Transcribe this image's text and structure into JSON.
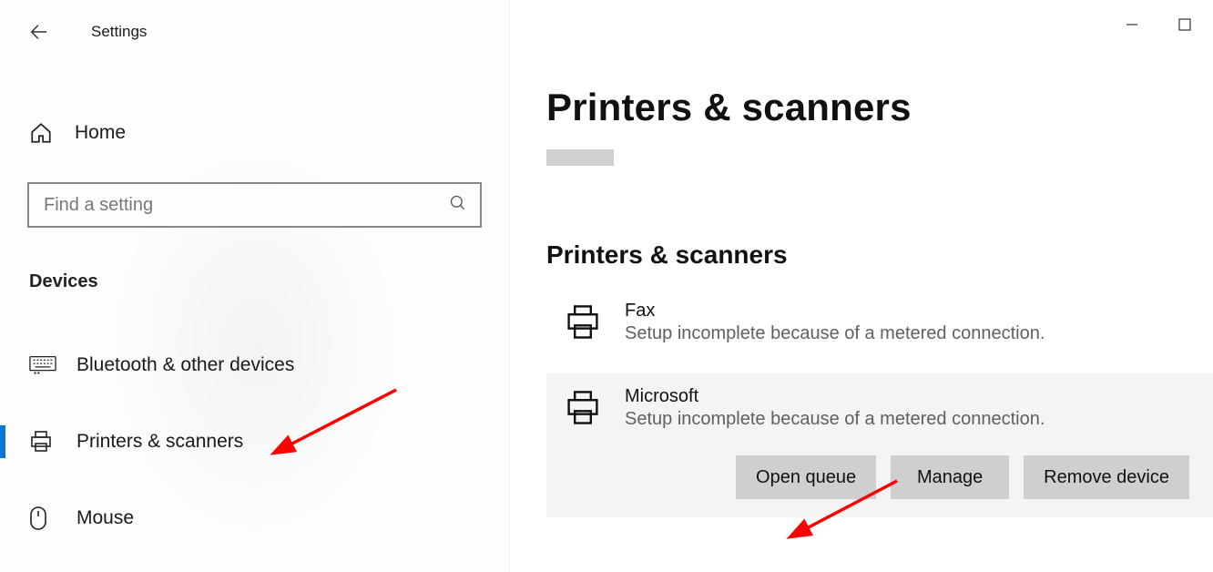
{
  "titlebar": {
    "app_name": "Settings"
  },
  "sidebar": {
    "home_label": "Home",
    "search_placeholder": "Find a setting",
    "section_label": "Devices",
    "nav": [
      {
        "label": "Bluetooth & other devices"
      },
      {
        "label": "Printers & scanners"
      },
      {
        "label": "Mouse"
      }
    ]
  },
  "content": {
    "page_title": "Printers & scanners",
    "section_heading": "Printers & scanners",
    "printers": [
      {
        "name": "Fax",
        "status": "Setup incomplete because of a metered connection."
      },
      {
        "name": "Microsoft",
        "status": "Setup incomplete because of a metered connection."
      }
    ],
    "actions": {
      "open_queue": "Open queue",
      "manage": "Manage",
      "remove": "Remove device"
    }
  }
}
